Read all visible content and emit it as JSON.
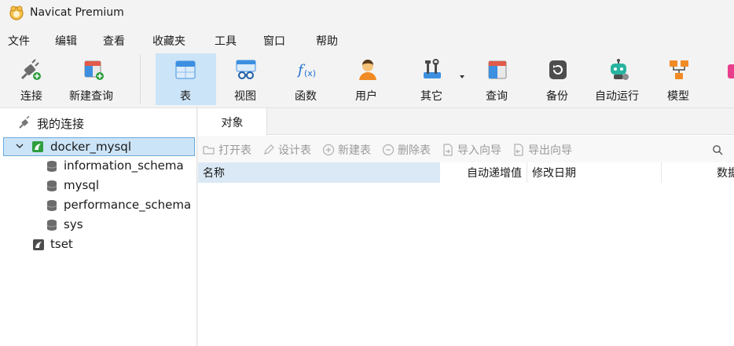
{
  "window": {
    "title": "Navicat Premium"
  },
  "menu": [
    "文件",
    "编辑",
    "查看",
    "收藏夹",
    "工具",
    "窗口",
    "帮助"
  ],
  "toolbar": {
    "connect": "连接",
    "new_query": "新建查询",
    "table": "表",
    "view": "视图",
    "function": "函数",
    "user": "用户",
    "other": "其它",
    "query": "查询",
    "backup": "备份",
    "automation": "自动运行",
    "model": "模型"
  },
  "sidebar": {
    "root_label": "我的连接",
    "connection": "docker_mysql",
    "databases": [
      "information_schema",
      "mysql",
      "performance_schema",
      "sys"
    ],
    "other_connection": "tset"
  },
  "tabs": {
    "objects": "对象"
  },
  "object_toolbar": {
    "open_table": "打开表",
    "design_table": "设计表",
    "new_table": "新建表",
    "delete_table": "删除表",
    "import_wizard": "导入向导",
    "export_wizard": "导出向导"
  },
  "table": {
    "columns": [
      "名称",
      "自动递增值",
      "修改日期",
      "数据"
    ]
  },
  "colors": {
    "selection": "#cce4f7",
    "accent": "#0078d4",
    "header_highlight": "#dbe9f6"
  }
}
